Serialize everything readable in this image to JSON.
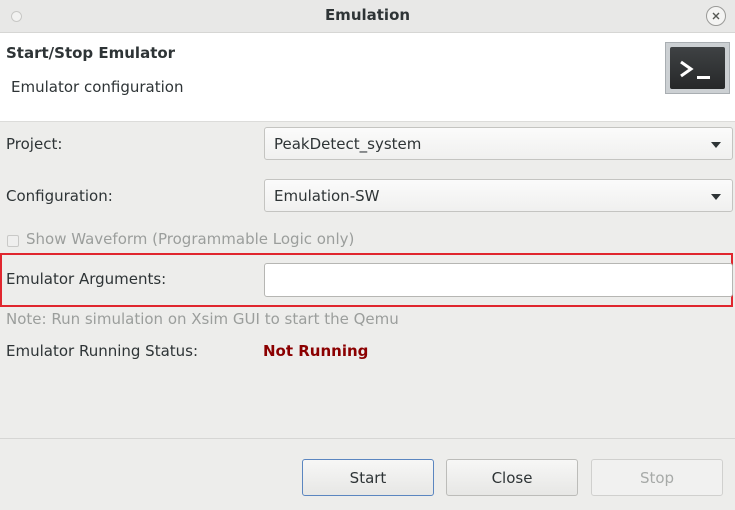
{
  "window": {
    "title": "Emulation"
  },
  "header": {
    "title": "Start/Stop Emulator",
    "subtitle": "Emulator configuration",
    "icon": "terminal-icon"
  },
  "form": {
    "project": {
      "label": "Project:",
      "value": "PeakDetect_system"
    },
    "configuration": {
      "label": "Configuration:",
      "value": "Emulation-SW"
    },
    "show_waveform": {
      "label": "Show Waveform (Programmable Logic only)",
      "checked": false,
      "enabled": false
    },
    "emulator_arguments": {
      "label": "Emulator Arguments:",
      "value": ""
    },
    "note": "Note: Run simulation on Xsim GUI to start the Qemu",
    "status": {
      "label": "Emulator Running Status:",
      "value": "Not Running",
      "color": "#8b0000"
    }
  },
  "buttons": {
    "start": "Start",
    "close": "Close",
    "stop": "Stop"
  },
  "colors": {
    "highlight": "#e0262e",
    "default_button_border": "#5b86c0"
  }
}
